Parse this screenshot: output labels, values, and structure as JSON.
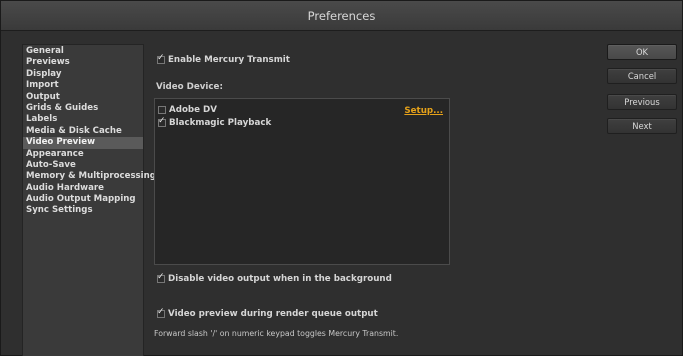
{
  "window": {
    "title": "Preferences"
  },
  "sidebar": {
    "items": [
      {
        "label": "General"
      },
      {
        "label": "Previews"
      },
      {
        "label": "Display"
      },
      {
        "label": "Import"
      },
      {
        "label": "Output"
      },
      {
        "label": "Grids & Guides"
      },
      {
        "label": "Labels"
      },
      {
        "label": "Media & Disk Cache"
      },
      {
        "label": "Video Preview",
        "selected": true
      },
      {
        "label": "Appearance"
      },
      {
        "label": "Auto-Save"
      },
      {
        "label": "Memory & Multiprocessing"
      },
      {
        "label": "Audio Hardware"
      },
      {
        "label": "Audio Output Mapping"
      },
      {
        "label": "Sync Settings"
      }
    ]
  },
  "main": {
    "enable_mercury": {
      "label": "Enable Mercury Transmit",
      "checked": true
    },
    "video_device_label": "Video Device:",
    "devices": [
      {
        "label": "Adobe DV",
        "checked": false,
        "setup_label": "Setup..."
      },
      {
        "label": "Blackmagic Playback",
        "checked": true
      }
    ],
    "disable_background": {
      "label": "Disable video output when in the background",
      "checked": true
    },
    "render_queue": {
      "label": "Video preview during render queue output",
      "checked": true
    },
    "note": "Forward slash '/' on numeric keypad toggles Mercury Transmit."
  },
  "buttons": {
    "ok": "OK",
    "cancel": "Cancel",
    "previous": "Previous",
    "next": "Next"
  }
}
